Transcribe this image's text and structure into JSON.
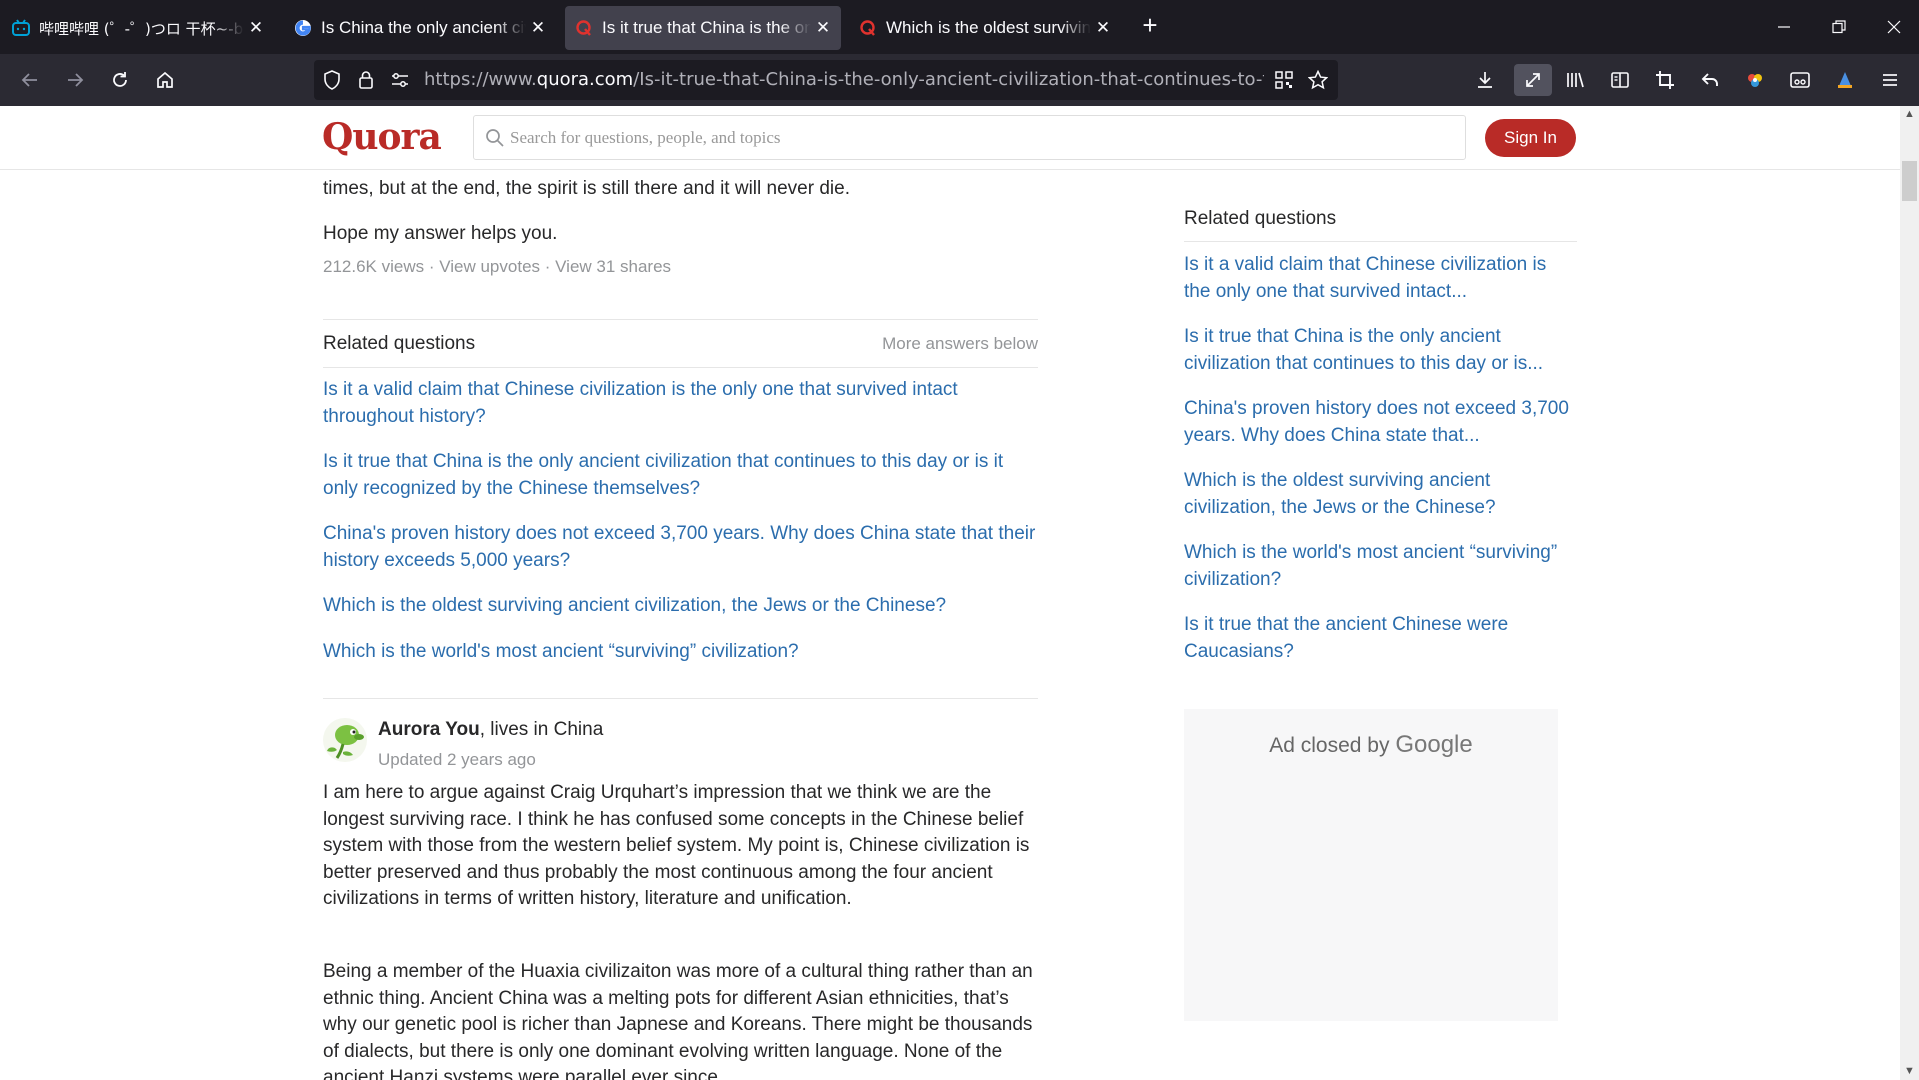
{
  "browser": {
    "tabs": [
      {
        "title": "哔哩哔哩 (゜-゜)つロ 干杯~-bilibili",
        "icon": "bilibili-icon"
      },
      {
        "title": "Is China the only ancient civilization",
        "icon": "google-icon"
      },
      {
        "title": "Is it true that China is the only ancient",
        "icon": "quora-icon",
        "active": true
      },
      {
        "title": "Which is the oldest surviving ancient",
        "icon": "quora-icon"
      }
    ],
    "url_prefix": "https://www.",
    "url_host": "quora.com",
    "url_path": "/Is-it-true-that-China-is-the-only-ancient-civilization-that-continues-to-this-day-or-is-it-only-recognized-by-the-Chinese-themselves"
  },
  "header": {
    "logo": "Quora",
    "search_placeholder": "Search for questions, people, and topics",
    "signin_label": "Sign In"
  },
  "answer_prev": {
    "tail_text": "times, but at the end, the spirit is still there and it will never die.",
    "closing": "Hope my answer helps you.",
    "stats": "212.6K views · View upvotes · View 31 shares"
  },
  "related_inline": {
    "title": "Related questions",
    "more": "More answers below",
    "items": [
      "Is it a valid claim that Chinese civilization is the only one that survived intact throughout history?",
      "Is it true that China is the only ancient civilization that continues to this day or is it only recognized by the Chinese themselves?",
      "China's proven history does not exceed 3,700 years. Why does China state that their history exceeds 5,000 years?",
      "Which is the oldest surviving ancient civilization, the Jews or the Chinese?",
      "Which is the world's most ancient “surviving” civilization?"
    ]
  },
  "answer_next": {
    "author": "Aurora You",
    "credential": ", lives in China",
    "updated": "Updated 2 years ago",
    "p1": "I am here to argue against Craig Urquhart’s impression that we think we are the longest surviving race. I think he has confused some concepts in the Chinese belief system with those from the western belief system. My point is, Chinese civilization is better preserved and thus probably the most continuous among the four ancient civilizations in terms of written history, literature and unification.",
    "p2": "Being a member of the Huaxia civilizaiton was more of a cultural thing rather than an ethnic thing. Ancient China was a melting pots for different Asian ethnicities, that’s why our genetic pool is richer than Japnese and Koreans. There might be thousands of dialects, but there is only one dominant evolving written language. None of the ancient Hanzi systems were parallel ever since"
  },
  "sidebar": {
    "title": "Related questions",
    "items": [
      "Is it a valid claim that Chinese civilization is the only one that survived intact...",
      "Is it true that China is the only ancient civilization that continues to this day or is...",
      "China's proven history does not exceed 3,700 years. Why does China state that...",
      "Which is the oldest surviving ancient civilization, the Jews or the Chinese?",
      "Which is the world's most ancient “surviving” civilization?",
      "Is it true that the ancient Chinese were Caucasians?"
    ],
    "ad_text": "Ad closed by",
    "ad_brand": "Google"
  },
  "colors": {
    "quora_red": "#b92b27",
    "link_blue": "#2b6dad",
    "chrome_dark": "#1c1b22"
  }
}
